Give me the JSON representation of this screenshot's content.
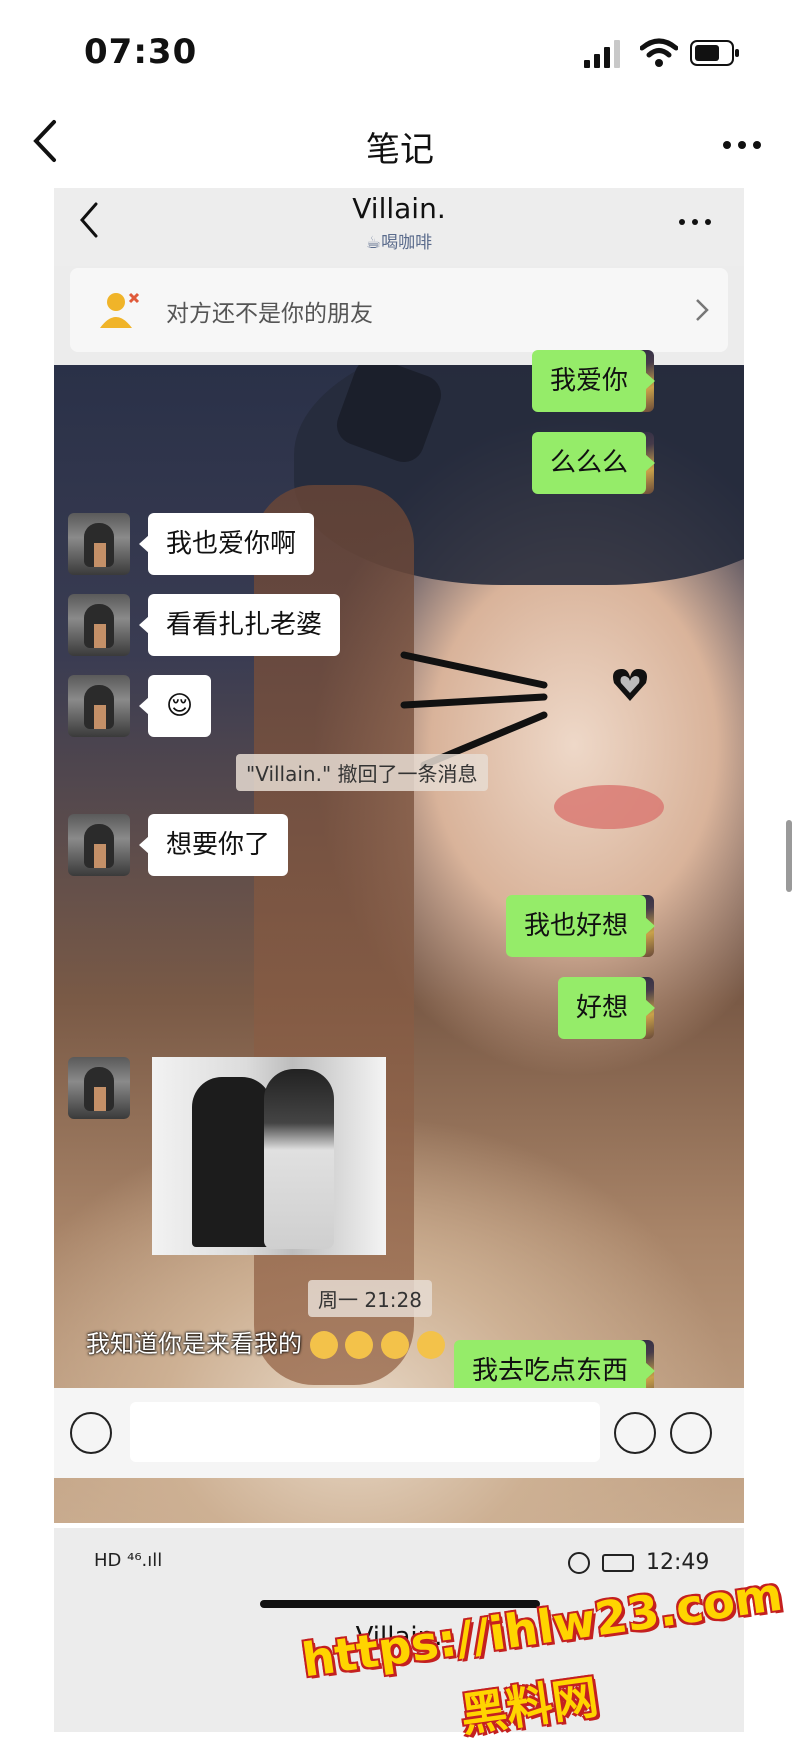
{
  "status_bar": {
    "time": "07:30"
  },
  "note_header": {
    "title": "笔记"
  },
  "chat": {
    "contact_name": "Villain.",
    "contact_status": "☕喝咖啡",
    "notice": "对方还不是你的朋友",
    "messages": [
      {
        "side": "me",
        "text": "我爱你"
      },
      {
        "side": "me",
        "text": "么么么"
      },
      {
        "side": "them",
        "text": "我也爱你啊"
      },
      {
        "side": "them",
        "text": "看看扎扎老婆"
      },
      {
        "side": "them",
        "text": "😌"
      },
      {
        "side": "system",
        "text": "\"Villain.\" 撤回了一条消息"
      },
      {
        "side": "them",
        "text": "想要你了"
      },
      {
        "side": "me",
        "text": "我也好想"
      },
      {
        "side": "me",
        "text": "好想"
      },
      {
        "side": "them",
        "type": "image"
      },
      {
        "side": "system",
        "text": "周一 21:28"
      },
      {
        "side": "me",
        "text": "我去吃点东西"
      }
    ],
    "overlay_caption": "我知道你是来看我的"
  },
  "preview": {
    "time": "12:49",
    "status_icons": "HD ⁴⁶.ıll",
    "title": "Villain."
  },
  "watermark": {
    "url": "https://ihlw23.com",
    "name": "黑料网"
  },
  "colors": {
    "sent_bubble": "#95ec69",
    "received_bubble": "#ffffff",
    "watermark_fill": "#ffd400",
    "watermark_outline": "#c42020"
  }
}
